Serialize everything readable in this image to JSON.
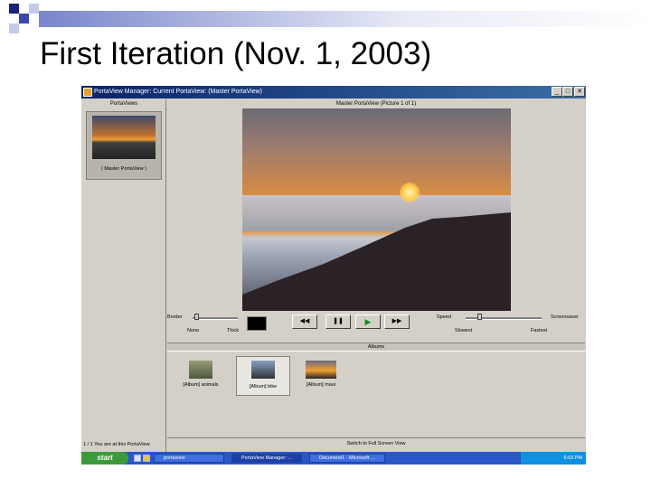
{
  "slide": {
    "title": "First Iteration (Nov. 1, 2003)"
  },
  "window": {
    "title": "PortaView Manager: Current PortaView: (Master PortaView)"
  },
  "left_pane": {
    "header": "PortaViews",
    "selected_item": "( Master PortaView )",
    "status_text": "1 / 1 You are at this PortaView"
  },
  "main": {
    "header": "Master PortaView (Picture 1 of 1)",
    "border_label": "Border",
    "border_min": "None",
    "border_max": "Thick",
    "speed_label": "Speed",
    "speed_min": "Slowest",
    "speed_max": "Fastest",
    "screensaver_label": "Screensaver",
    "buttons": {
      "rewind": "◀◀",
      "pause": "❚❚",
      "play": "▶",
      "forward": "▶▶"
    }
  },
  "albums": {
    "header": "Albums",
    "items": [
      {
        "label": "[Album] animals"
      },
      {
        "label": "[Album] bike"
      },
      {
        "label": "[Album] maui"
      }
    ]
  },
  "switch_label": "Switch to Full Screen View",
  "taskbar": {
    "start": "start",
    "tasks": [
      {
        "label": "portaview"
      },
      {
        "label": "PortaView Manager: ..."
      },
      {
        "label": "Document1 - Microsoft ..."
      }
    ],
    "clock": "6:03 PM"
  },
  "colors": {
    "title_bar": "#0a246a",
    "taskbar": "#2a56c8",
    "start_button": "#3c9a3c",
    "play_icon": "#1c8a1c"
  }
}
